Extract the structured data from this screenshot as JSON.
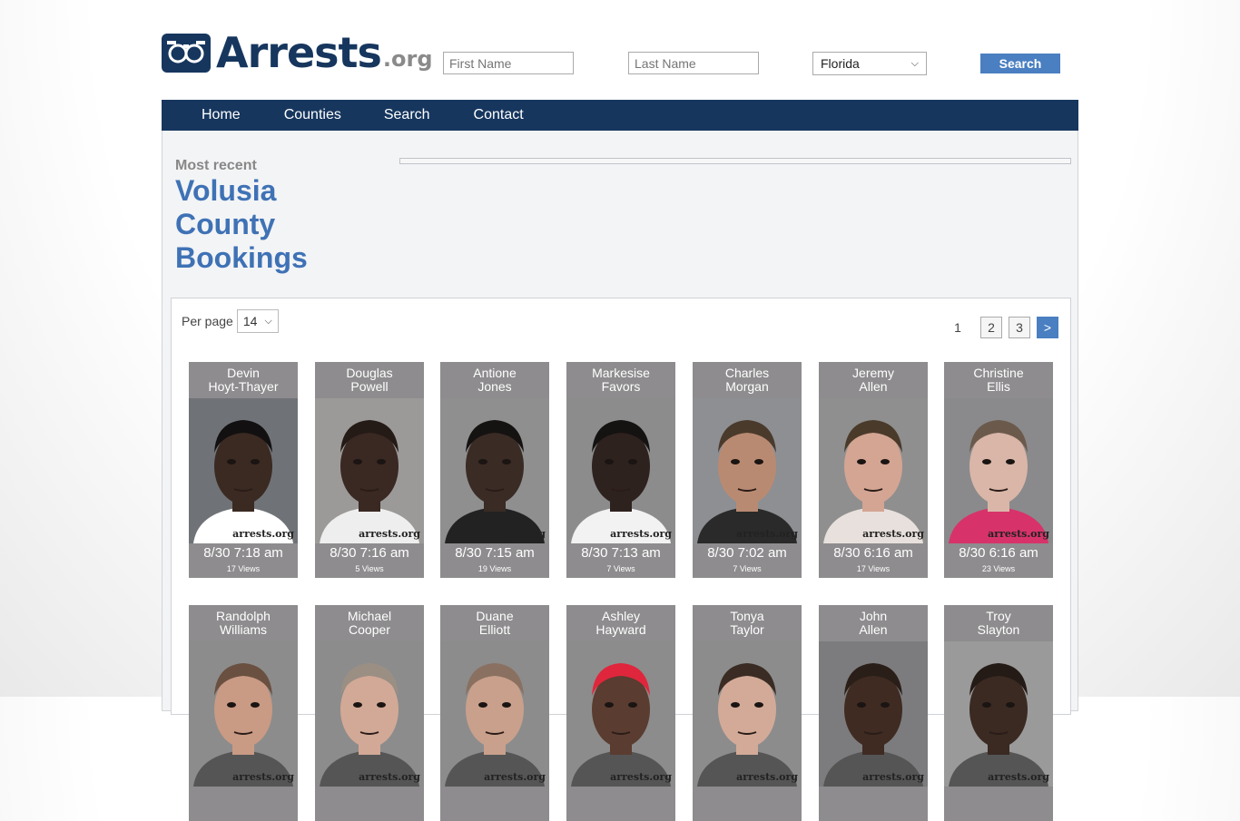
{
  "header": {
    "logo_text": "Arrests",
    "logo_suffix": ".org",
    "first_name_placeholder": "First Name",
    "last_name_placeholder": "Last Name",
    "state_selected": "Florida",
    "search_label": "Search"
  },
  "nav": {
    "items": [
      {
        "label": "Home"
      },
      {
        "label": "Counties"
      },
      {
        "label": "Search"
      },
      {
        "label": "Contact"
      }
    ]
  },
  "main": {
    "most_recent": "Most recent",
    "title_line1": "Volusia",
    "title_line2": "County",
    "title_line3": "Bookings"
  },
  "listing": {
    "per_page_label": "Per page",
    "per_page_value": "14",
    "pagination": {
      "current": "1",
      "pages": [
        "2",
        "3"
      ],
      "next": ">"
    },
    "watermark": "arrests.org",
    "cards": [
      {
        "first": "Devin",
        "last": "Hoyt-Thayer",
        "time": "8/30 7:18 am",
        "views": "17 Views",
        "bg": "#6f7378",
        "skin": "#3b2a22",
        "hair": "#121010",
        "shirt": "#ffffff"
      },
      {
        "first": "Douglas",
        "last": "Powell",
        "time": "8/30 7:16 am",
        "views": "5 Views",
        "bg": "#9b9a98",
        "skin": "#3a2822",
        "hair": "#241a16",
        "shirt": "#eeeeee"
      },
      {
        "first": "Antione",
        "last": "Jones",
        "time": "8/30 7:15 am",
        "views": "19 Views",
        "bg": "#8f8f8f",
        "skin": "#3a2b25",
        "hair": "#151212",
        "shirt": "#222222"
      },
      {
        "first": "Markesise",
        "last": "Favors",
        "time": "8/30 7:13 am",
        "views": "7 Views",
        "bg": "#8c8c8c",
        "skin": "#2e221e",
        "hair": "#151212",
        "shirt": "#f2f2f2"
      },
      {
        "first": "Charles",
        "last": "Morgan",
        "time": "8/30 7:02 am",
        "views": "7 Views",
        "bg": "#8d8f93",
        "skin": "#b98a72",
        "hair": "#4a3a2c",
        "shirt": "#2a2a2a"
      },
      {
        "first": "Jeremy",
        "last": "Allen",
        "time": "8/30 6:16 am",
        "views": "17 Views",
        "bg": "#8f8f8f",
        "skin": "#d4a593",
        "hair": "#4a3a2a",
        "shirt": "#e8e0dc"
      },
      {
        "first": "Christine",
        "last": "Ellis",
        "time": "8/30 6:16 am",
        "views": "23 Views",
        "bg": "#8a8a8c",
        "skin": "#d9b6a8",
        "hair": "#6b5a4c",
        "shirt": "#d7336a"
      },
      {
        "first": "Randolph",
        "last": "Williams",
        "time": "",
        "views": "",
        "bg": "#8c8c8c",
        "skin": "#c99a84",
        "hair": "#6a5040",
        "shirt": "#555"
      },
      {
        "first": "Michael",
        "last": "Cooper",
        "time": "",
        "views": "",
        "bg": "#8c8c8c",
        "skin": "#d2a996",
        "hair": "#9b8f84",
        "shirt": "#555"
      },
      {
        "first": "Duane",
        "last": "Elliott",
        "time": "",
        "views": "",
        "bg": "#8c8c8c",
        "skin": "#c9a08c",
        "hair": "#8a7060",
        "shirt": "#555"
      },
      {
        "first": "Ashley",
        "last": "Hayward",
        "time": "",
        "views": "",
        "bg": "#8c8c8c",
        "skin": "#5a3c30",
        "hair": "#e0263c",
        "shirt": "#555"
      },
      {
        "first": "Tonya",
        "last": "Taylor",
        "time": "",
        "views": "",
        "bg": "#8c8c8c",
        "skin": "#d3aa98",
        "hair": "#3a2c24",
        "shirt": "#555"
      },
      {
        "first": "John",
        "last": "Allen",
        "time": "",
        "views": "",
        "bg": "#7c7c7e",
        "skin": "#3f2b22",
        "hair": "#2a1e18",
        "shirt": "#555"
      },
      {
        "first": "Troy",
        "last": "Slayton",
        "time": "",
        "views": "",
        "bg": "#9a9a9a",
        "skin": "#3a2a22",
        "hair": "#241a16",
        "shirt": "#555"
      }
    ]
  },
  "colors": {
    "navy": "#16365e",
    "accent_blue": "#4a7fc1",
    "title_blue": "#3f72b5",
    "card_gray": "#8e8c8e"
  }
}
